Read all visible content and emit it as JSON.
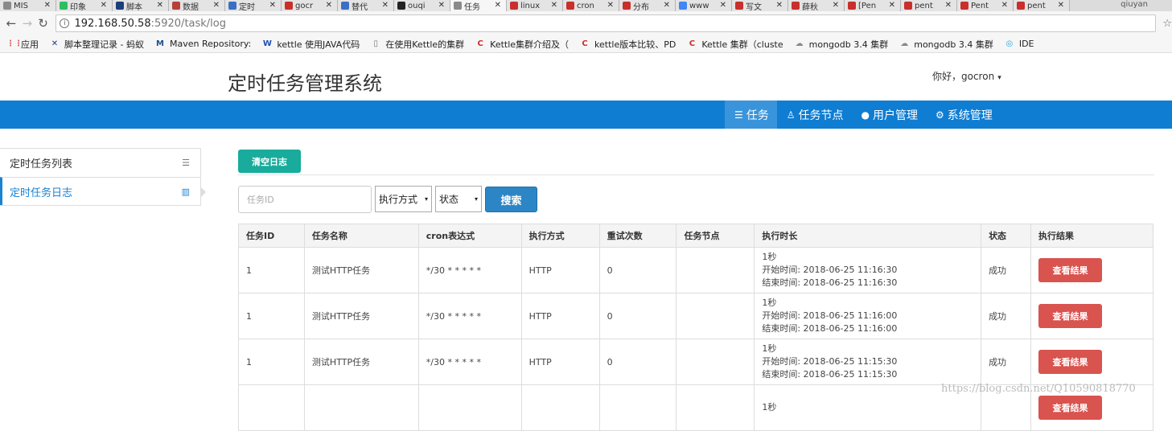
{
  "browser": {
    "tabs": [
      {
        "title": "MIS",
        "color": "#8a8a8a",
        "icon": "document-icon"
      },
      {
        "title": "印象",
        "color": "#2dbe60",
        "icon": "evernote-icon"
      },
      {
        "title": "脚本",
        "color": "#1c3f7a",
        "icon": "x-logo-icon"
      },
      {
        "title": "数据",
        "color": "#b5413a",
        "icon": "badge-icon"
      },
      {
        "title": "定时",
        "color": "#3b6fc5",
        "icon": "globe-icon"
      },
      {
        "title": "gocr",
        "color": "#c9302c",
        "icon": "csdn-icon"
      },
      {
        "title": "替代",
        "color": "#3b6fc5",
        "icon": "cross-icon"
      },
      {
        "title": "ouqi",
        "color": "#222222",
        "icon": "github-icon"
      },
      {
        "title": "任务",
        "color": "#8a8a8a",
        "icon": "page-icon",
        "active": true
      },
      {
        "title": "linux",
        "color": "#c9302c",
        "icon": "csdn-icon"
      },
      {
        "title": "cron",
        "color": "#c9302c",
        "icon": "csdn-icon"
      },
      {
        "title": "分布",
        "color": "#c9302c",
        "icon": "csdn-icon"
      },
      {
        "title": "www",
        "color": "#4285f4",
        "icon": "google-icon"
      },
      {
        "title": "写文",
        "color": "#c9302c",
        "icon": "csdn-icon"
      },
      {
        "title": "薛秋",
        "color": "#c9302c",
        "icon": "csdn-icon"
      },
      {
        "title": "[Pen",
        "color": "#c9302c",
        "icon": "csdn-icon"
      },
      {
        "title": "pent",
        "color": "#c9302c",
        "icon": "csdn-icon"
      },
      {
        "title": "Pent",
        "color": "#c9302c",
        "icon": "csdn-icon"
      },
      {
        "title": "pent",
        "color": "#c9302c",
        "icon": "csdn-icon"
      }
    ],
    "tab_close": "✕",
    "profile": "qiuyan",
    "url_host": "192.168.50.58",
    "url_path": ":5920/task/log",
    "bookmarks": [
      {
        "label": "应用",
        "icon": "apps-icon",
        "glyph": "⋮⋮",
        "color": "#d9534f"
      },
      {
        "label": "脚本整理记录 - 蚂蚁",
        "icon": "x-logo-icon",
        "glyph": "✕",
        "color": "#1c3f7a"
      },
      {
        "label": "Maven Repository:",
        "icon": "maven-icon",
        "glyph": "M",
        "color": "#1d4f91"
      },
      {
        "label": "kettle 使用JAVA代码",
        "icon": "w-logo-icon",
        "glyph": "W",
        "color": "#1d4fb5"
      },
      {
        "label": "在使用Kettle的集群",
        "icon": "page-icon",
        "glyph": "▯",
        "color": "#777777"
      },
      {
        "label": "Kettle集群介绍及（",
        "icon": "csdn-icon",
        "glyph": "C",
        "color": "#c9302c"
      },
      {
        "label": "kettle版本比较、PD",
        "icon": "csdn-icon",
        "glyph": "C",
        "color": "#c9302c"
      },
      {
        "label": "Kettle 集群（cluste",
        "icon": "csdn-icon",
        "glyph": "C",
        "color": "#c9302c"
      },
      {
        "label": "mongodb 3.4 集群",
        "icon": "cloud-icon",
        "glyph": "☁",
        "color": "#888888"
      },
      {
        "label": "mongodb 3.4 集群",
        "icon": "cloud-icon",
        "glyph": "☁",
        "color": "#888888"
      },
      {
        "label": "IDE",
        "icon": "ide-icon",
        "glyph": "◎",
        "color": "#2aa3d8"
      }
    ]
  },
  "header": {
    "title": "定时任务管理系统",
    "greeting": "你好，gocron",
    "caret": "▾"
  },
  "nav": [
    {
      "label": "任务",
      "glyph": "☰",
      "icon": "list-icon",
      "active": true
    },
    {
      "label": "任务节点",
      "glyph": "♙",
      "icon": "node-icon"
    },
    {
      "label": "用户管理",
      "glyph": "●",
      "icon": "user-icon"
    },
    {
      "label": "系统管理",
      "glyph": "⚙",
      "icon": "gear-icon"
    }
  ],
  "sidebar": [
    {
      "label": "定时任务列表",
      "glyph": "☰",
      "icon": "list-icon"
    },
    {
      "label": "定时任务日志",
      "glyph": "▥",
      "icon": "bar-chart-icon",
      "active": true
    }
  ],
  "toolbar": {
    "clear_label": "清空日志",
    "task_id_placeholder": "任务ID",
    "exec_mode": "执行方式",
    "status": "状态",
    "search_label": "搜索",
    "caret": "▾"
  },
  "table": {
    "columns": [
      "任务ID",
      "任务名称",
      "cron表达式",
      "执行方式",
      "重试次数",
      "任务节点",
      "执行时长",
      "状态",
      "执行结果"
    ],
    "rows": [
      {
        "id": "1",
        "name": "测试HTTP任务",
        "cron": "*/30 * * * * *",
        "mode": "HTTP",
        "retry": "0",
        "node": "",
        "duration": "1秒",
        "start": "开始时间: 2018-06-25 11:16:30",
        "end": "结束时间: 2018-06-25 11:16:30",
        "status": "成功",
        "action": "查看结果"
      },
      {
        "id": "1",
        "name": "测试HTTP任务",
        "cron": "*/30 * * * * *",
        "mode": "HTTP",
        "retry": "0",
        "node": "",
        "duration": "1秒",
        "start": "开始时间: 2018-06-25 11:16:00",
        "end": "结束时间: 2018-06-25 11:16:00",
        "status": "成功",
        "action": "查看结果"
      },
      {
        "id": "1",
        "name": "测试HTTP任务",
        "cron": "*/30 * * * * *",
        "mode": "HTTP",
        "retry": "0",
        "node": "",
        "duration": "1秒",
        "start": "开始时间: 2018-06-25 11:15:30",
        "end": "结束时间: 2018-06-25 11:15:30",
        "status": "成功",
        "action": "查看结果"
      },
      {
        "id": "",
        "name": "",
        "cron": "",
        "mode": "",
        "retry": "",
        "node": "",
        "duration": "1秒",
        "start": "",
        "end": "",
        "status": "",
        "action": "查看结果"
      }
    ]
  },
  "watermark": "https://blog.csdn.net/Q10590818770"
}
